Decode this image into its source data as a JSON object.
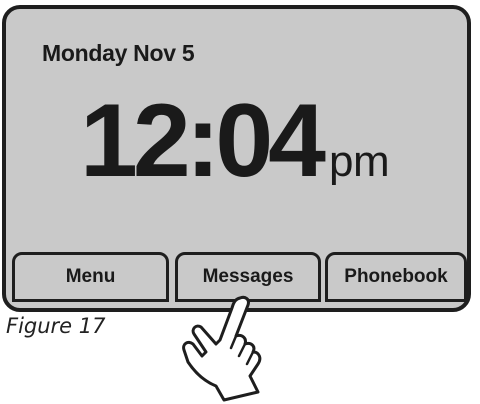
{
  "screen": {
    "date": "Monday Nov 5",
    "time": "12:04",
    "ampm": "pm"
  },
  "softkeys": {
    "menu": "Menu",
    "messages": "Messages",
    "phonebook": "Phonebook"
  },
  "caption": "Figure 17",
  "icons": {
    "pointer": "pointing-hand-icon"
  },
  "colors": {
    "screen_bg": "#c9c9c9",
    "border": "#1e1e1e",
    "text": "#1a1a1a"
  }
}
